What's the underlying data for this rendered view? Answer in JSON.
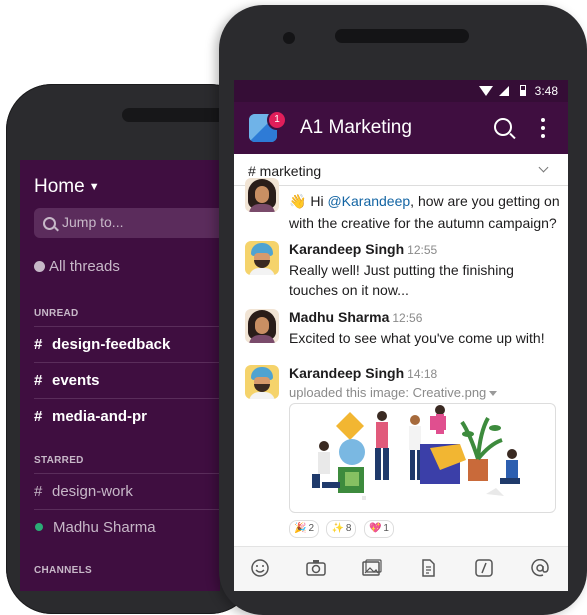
{
  "sidebar": {
    "title": "Home",
    "jump_placeholder": "Jump to...",
    "threads": "All threads",
    "sections": {
      "unread": "UNREAD",
      "starred": "STARRED",
      "channels": "CHANNELS"
    },
    "unread_channels": [
      "design-feedback",
      "events",
      "media-and-pr"
    ],
    "starred_items": [
      "design-work",
      "Madhu Sharma"
    ]
  },
  "status": {
    "time": "3:48"
  },
  "header": {
    "workspace": "A1 Marketing",
    "badge": "1"
  },
  "channel": {
    "name": "# marketing"
  },
  "messages": [
    {
      "line1_pre": "Hi ",
      "mention": "@Karandeep",
      "line1_post": ", how are you getting on",
      "line2": "with the creative for the autumn campaign?"
    },
    {
      "sender": "Karandeep Singh",
      "time": "12:55",
      "line1": "Really well! Just putting the finishing",
      "line2": "touches on it now..."
    },
    {
      "sender": "Madhu Sharma",
      "time": "12:56",
      "line1": "Excited to see what you've come up with!"
    },
    {
      "sender": "Karandeep Singh",
      "time": "14:18",
      "upload": "uploaded this image: Creative.png"
    }
  ],
  "reactions": [
    {
      "emoji": "🎉",
      "count": "2"
    },
    {
      "emoji": "✨",
      "count": "8"
    },
    {
      "emoji": "💖",
      "count": "1"
    }
  ],
  "toolbar": [
    "emoji-icon",
    "camera-icon",
    "gallery-icon",
    "file-icon",
    "slash-command-icon",
    "mention-icon"
  ]
}
